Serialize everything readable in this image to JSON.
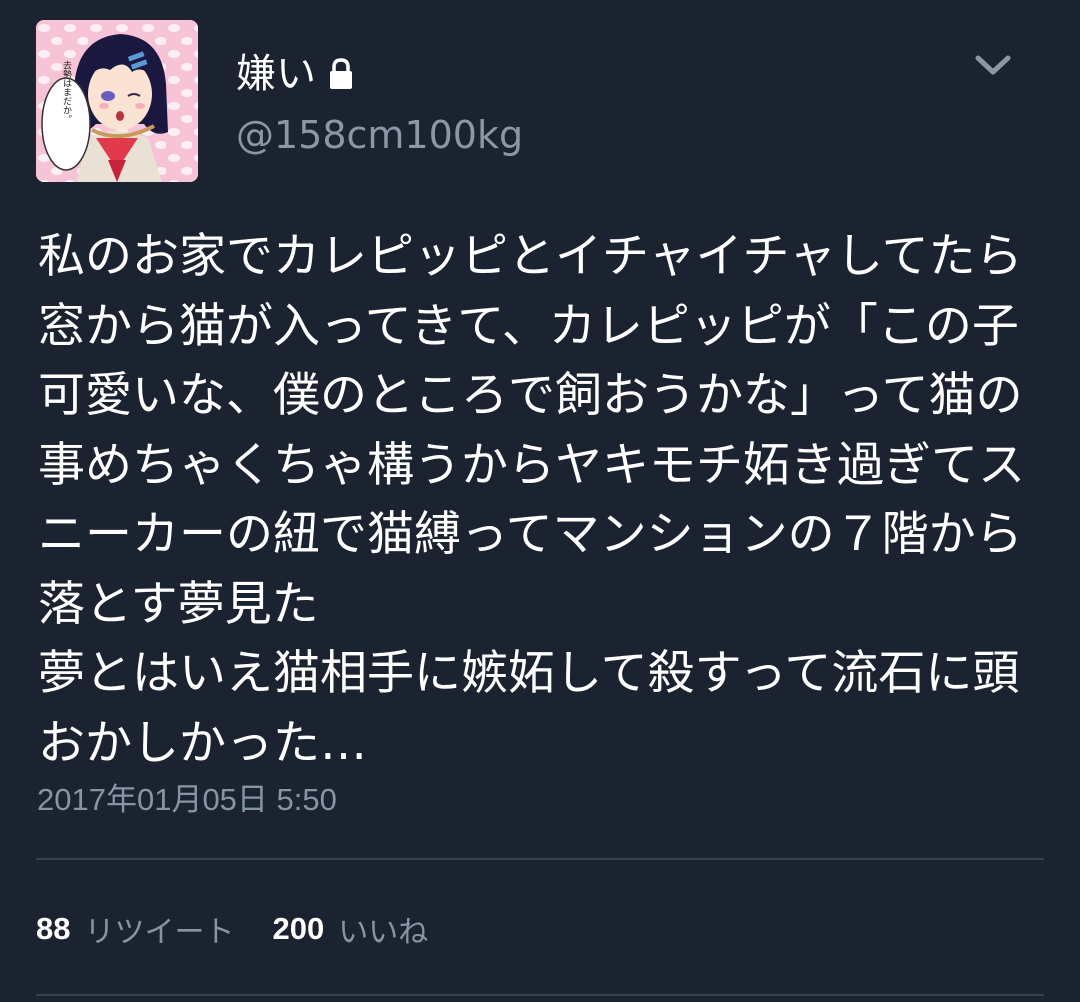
{
  "user": {
    "display_name": "嫌い",
    "handle": "@158cm100kg",
    "protected_icon": "lock-icon",
    "avatar_speech_text": "去勢はまだか。"
  },
  "menu_icon": "chevron-down-icon",
  "tweet": {
    "text": "私のお家でカレピッピとイチャイチャしてたら窓から猫が入ってきて、カレピッピが「この子可愛いな、僕のところで飼おうかな」って猫の事めちゃくちゃ構うからヤキモチ妬き過ぎてスニーカーの紐で猫縛ってマンションの７階から落とす夢見た\n夢とはいえ猫相手に嫉妬して殺すって流石に頭おかしかった…",
    "timestamp": "2017年01月05日 5:50"
  },
  "stats": {
    "retweets_count": "88",
    "retweets_label": "リツイート",
    "likes_count": "200",
    "likes_label": "いいね"
  },
  "colors": {
    "background": "#1b2330",
    "text_primary": "#ffffff",
    "text_secondary": "#8595a5",
    "divider": "#364150"
  }
}
